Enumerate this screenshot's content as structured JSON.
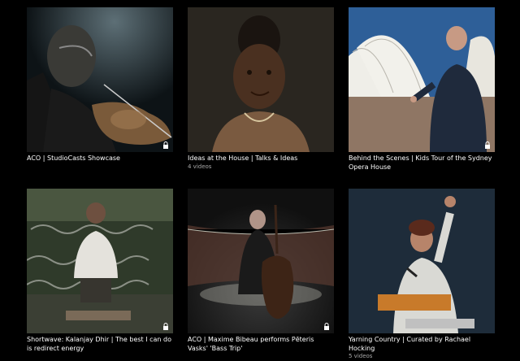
{
  "cards": [
    {
      "title": "ACO | StudioCasts Showcase",
      "count": ""
    },
    {
      "title": "Ideas at the House | Talks & Ideas",
      "count": "4 videos"
    },
    {
      "title": "Behind the Scenes | Kids Tour of the Sydney Opera House",
      "count": ""
    },
    {
      "title": "Shortwave: Kalanjay Dhir | The best I can do is redirect energy",
      "count": ""
    },
    {
      "title": "ACO | Maxime Bibeau performs Pēteris Vasks' 'Bass Trip'",
      "count": ""
    },
    {
      "title": "Yarning Country | Curated by Rachael Hocking",
      "count": "5 videos"
    }
  ],
  "icons": {
    "locked": "padlock-icon"
  }
}
